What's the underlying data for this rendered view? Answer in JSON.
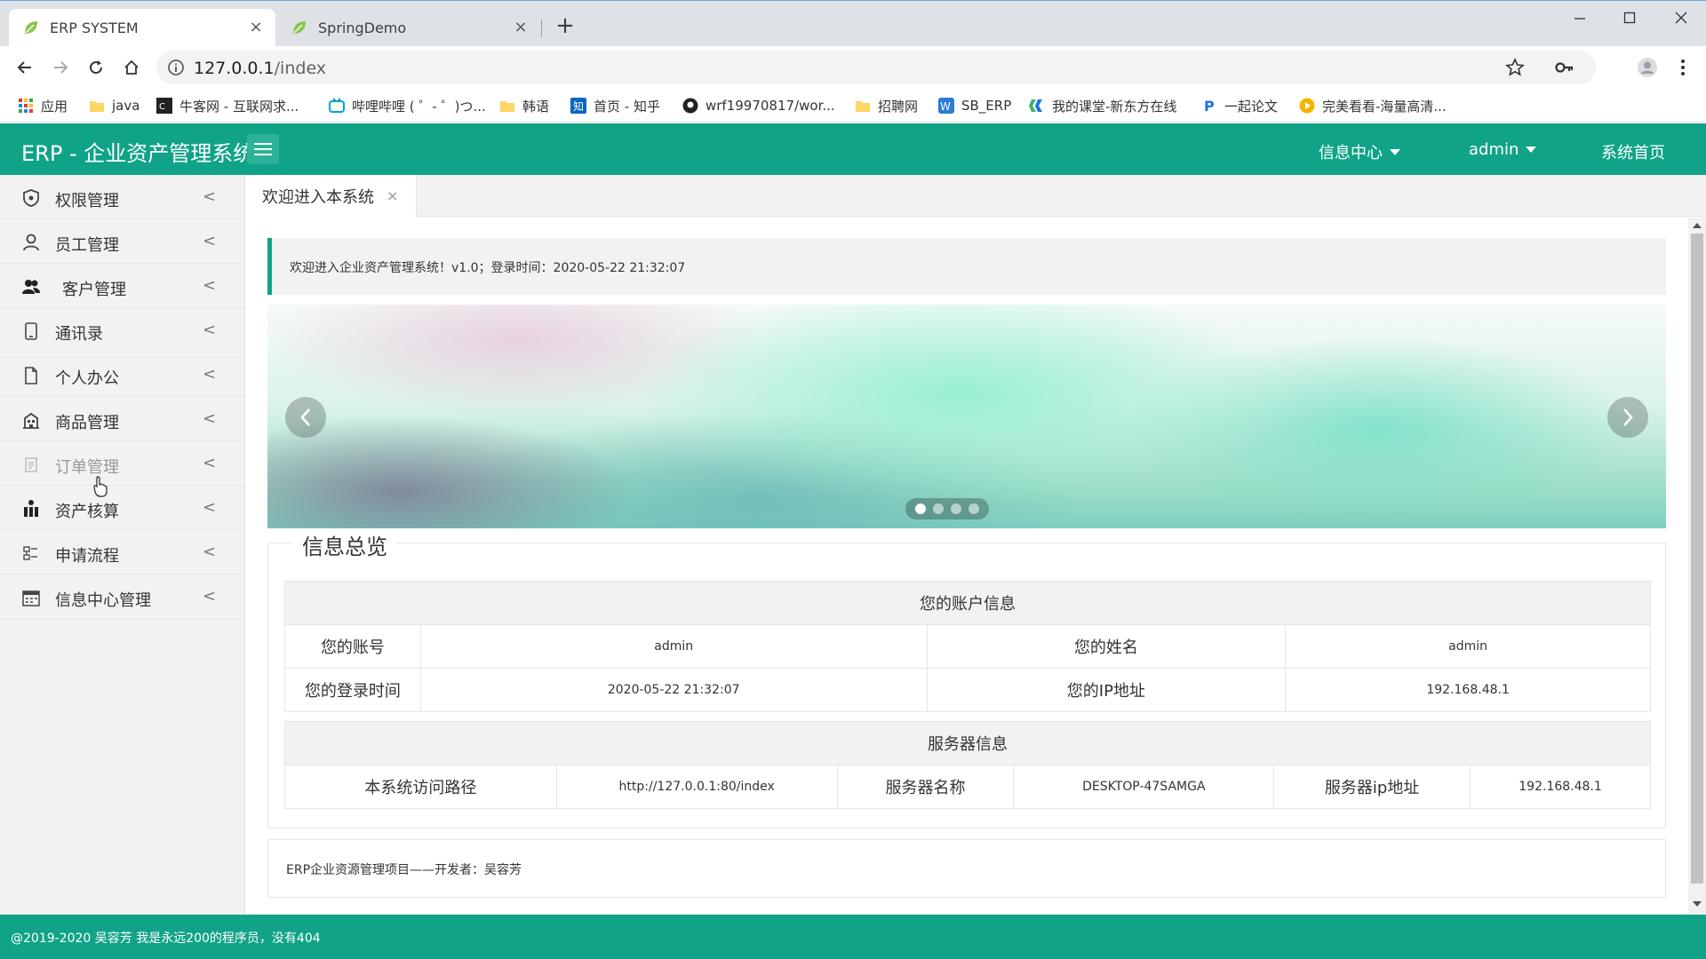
{
  "browser": {
    "tabs": [
      {
        "title": "ERP SYSTEM",
        "close": "×"
      },
      {
        "title": "SpringDemo",
        "close": "×"
      }
    ],
    "new_tab": "+",
    "url_host": "127.0.0.1",
    "url_path": "/index",
    "bookmarks": [
      {
        "label": "应用",
        "icon": "apps-grid-icon"
      },
      {
        "label": "java",
        "icon": "folder-icon"
      },
      {
        "label": "牛客网 - 互联网求...",
        "icon": "nowcoder-icon"
      },
      {
        "label": "哔哩哔哩 ( ゜- ゜)つ...",
        "icon": "bilibili-icon"
      },
      {
        "label": "韩语",
        "icon": "folder-icon"
      },
      {
        "label": "首页 - 知乎",
        "icon": "zhihu-icon"
      },
      {
        "label": "wrf19970817/wor...",
        "icon": "github-icon"
      },
      {
        "label": "招聘网",
        "icon": "folder-icon"
      },
      {
        "label": "SB_ERP",
        "icon": "word-icon"
      },
      {
        "label": "我的课堂-新东方在线",
        "icon": "xdf-icon"
      },
      {
        "label": "一起论文",
        "icon": "p-icon"
      },
      {
        "label": "完美看看-海量高清...",
        "icon": "play-icon"
      }
    ]
  },
  "app": {
    "logo": "ERP - 企业资产管理系统",
    "nav": [
      {
        "label": "信息中心"
      },
      {
        "label": "admin"
      },
      {
        "label": "系统首页"
      }
    ],
    "accent": "#11a387"
  },
  "sidebar": {
    "items": [
      {
        "label": "权限管理",
        "icon": "shield-icon"
      },
      {
        "label": "员工管理",
        "icon": "user-icon"
      },
      {
        "label": "客户管理",
        "icon": "users-icon"
      },
      {
        "label": "通讯录",
        "icon": "phone-icon"
      },
      {
        "label": "个人办公",
        "icon": "document-icon"
      },
      {
        "label": "商品管理",
        "icon": "building-icon"
      },
      {
        "label": "订单管理",
        "icon": "order-icon"
      },
      {
        "label": "资产核算",
        "icon": "asset-icon"
      },
      {
        "label": "申请流程",
        "icon": "flow-icon"
      },
      {
        "label": "信息中心管理",
        "icon": "calendar-icon"
      }
    ],
    "chevron": "<"
  },
  "page_tab": {
    "label": "欢迎进入本系统",
    "close": "×"
  },
  "welcome_text": "欢迎进入企业资产管理系统！v1.0；登录时间：2020-05-22 21:32:07",
  "carousel": {
    "slide_count": 4,
    "active_index": 0
  },
  "overview": {
    "legend": "信息总览",
    "account": {
      "header": "您的账户信息",
      "rows": [
        [
          "您的账号",
          "admin",
          "您的姓名",
          "admin"
        ],
        [
          "您的登录时间",
          "2020-05-22 21:32:07",
          "您的IP地址",
          "192.168.48.1"
        ]
      ]
    },
    "server": {
      "header": "服务器信息",
      "row": [
        "本系统访问路径",
        "http://127.0.0.1:80/index",
        "服务器名称",
        "DESKTOP-47SAMGA",
        "服务器ip地址",
        "192.168.48.1"
      ]
    }
  },
  "developer_text": "ERP企业资源管理项目——开发者：吴容芳",
  "footer_text": "@2019-2020 吴容芳 我是永远200的程序员，没有404"
}
